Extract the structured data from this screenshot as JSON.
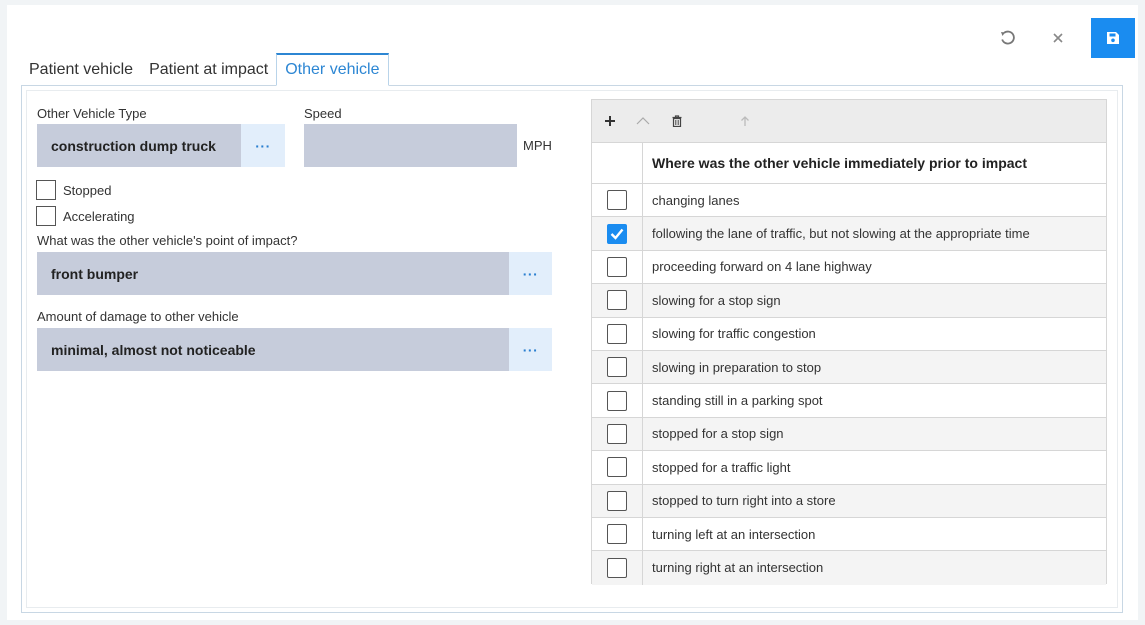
{
  "toolbar": {
    "undo_icon": "undo-icon",
    "close_icon": "close-icon",
    "save_icon": "save-icon",
    "save_color": "#1a8cf0"
  },
  "tabs": [
    {
      "label": "Patient vehicle",
      "active": false
    },
    {
      "label": "Patient at impact",
      "active": false
    },
    {
      "label": "Other vehicle",
      "active": true
    }
  ],
  "form": {
    "other_vehicle_type": {
      "label": "Other Vehicle Type",
      "value": "construction dump truck"
    },
    "speed": {
      "label": "Speed",
      "value": "",
      "unit": "MPH"
    },
    "stopped": {
      "label": "Stopped",
      "checked": false
    },
    "accelerating": {
      "label": "Accelerating",
      "checked": false
    },
    "point_of_impact": {
      "label": "What was the other vehicle's point of impact?",
      "value": "front bumper"
    },
    "damage": {
      "label": "Amount of damage to other vehicle",
      "value": "minimal, almost not noticeable"
    },
    "ellipsis": "···"
  },
  "grid": {
    "toolbar_icons": [
      "plus-icon",
      "chevron-up-icon",
      "trash-icon",
      "arrow-up-icon"
    ],
    "header": "Where was the other vehicle immediately prior to impact",
    "rows": [
      {
        "label": "changing lanes",
        "checked": false
      },
      {
        "label": "following the lane of traffic, but not slowing at the appropriate time",
        "checked": true
      },
      {
        "label": "proceeding forward on 4 lane highway",
        "checked": false
      },
      {
        "label": "slowing for a stop sign",
        "checked": false
      },
      {
        "label": "slowing for traffic congestion",
        "checked": false
      },
      {
        "label": "slowing in preparation to stop",
        "checked": false
      },
      {
        "label": "standing still in a parking spot",
        "checked": false
      },
      {
        "label": "stopped for a stop sign",
        "checked": false
      },
      {
        "label": "stopped for a traffic light",
        "checked": false
      },
      {
        "label": "stopped to turn right into a store",
        "checked": false
      },
      {
        "label": "turning left at an intersection",
        "checked": false
      },
      {
        "label": "turning right at an intersection",
        "checked": false
      }
    ]
  }
}
